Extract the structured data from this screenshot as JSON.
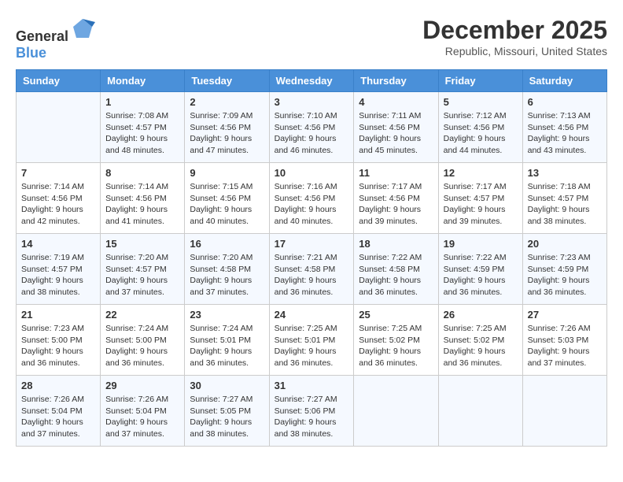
{
  "header": {
    "logo_general": "General",
    "logo_blue": "Blue",
    "title": "December 2025",
    "subtitle": "Republic, Missouri, United States"
  },
  "calendar": {
    "days_of_week": [
      "Sunday",
      "Monday",
      "Tuesday",
      "Wednesday",
      "Thursday",
      "Friday",
      "Saturday"
    ],
    "weeks": [
      [
        {
          "day": "",
          "info": ""
        },
        {
          "day": "1",
          "info": "Sunrise: 7:08 AM\nSunset: 4:57 PM\nDaylight: 9 hours\nand 48 minutes."
        },
        {
          "day": "2",
          "info": "Sunrise: 7:09 AM\nSunset: 4:56 PM\nDaylight: 9 hours\nand 47 minutes."
        },
        {
          "day": "3",
          "info": "Sunrise: 7:10 AM\nSunset: 4:56 PM\nDaylight: 9 hours\nand 46 minutes."
        },
        {
          "day": "4",
          "info": "Sunrise: 7:11 AM\nSunset: 4:56 PM\nDaylight: 9 hours\nand 45 minutes."
        },
        {
          "day": "5",
          "info": "Sunrise: 7:12 AM\nSunset: 4:56 PM\nDaylight: 9 hours\nand 44 minutes."
        },
        {
          "day": "6",
          "info": "Sunrise: 7:13 AM\nSunset: 4:56 PM\nDaylight: 9 hours\nand 43 minutes."
        }
      ],
      [
        {
          "day": "7",
          "info": "Sunrise: 7:14 AM\nSunset: 4:56 PM\nDaylight: 9 hours\nand 42 minutes."
        },
        {
          "day": "8",
          "info": "Sunrise: 7:14 AM\nSunset: 4:56 PM\nDaylight: 9 hours\nand 41 minutes."
        },
        {
          "day": "9",
          "info": "Sunrise: 7:15 AM\nSunset: 4:56 PM\nDaylight: 9 hours\nand 40 minutes."
        },
        {
          "day": "10",
          "info": "Sunrise: 7:16 AM\nSunset: 4:56 PM\nDaylight: 9 hours\nand 40 minutes."
        },
        {
          "day": "11",
          "info": "Sunrise: 7:17 AM\nSunset: 4:56 PM\nDaylight: 9 hours\nand 39 minutes."
        },
        {
          "day": "12",
          "info": "Sunrise: 7:17 AM\nSunset: 4:57 PM\nDaylight: 9 hours\nand 39 minutes."
        },
        {
          "day": "13",
          "info": "Sunrise: 7:18 AM\nSunset: 4:57 PM\nDaylight: 9 hours\nand 38 minutes."
        }
      ],
      [
        {
          "day": "14",
          "info": "Sunrise: 7:19 AM\nSunset: 4:57 PM\nDaylight: 9 hours\nand 38 minutes."
        },
        {
          "day": "15",
          "info": "Sunrise: 7:20 AM\nSunset: 4:57 PM\nDaylight: 9 hours\nand 37 minutes."
        },
        {
          "day": "16",
          "info": "Sunrise: 7:20 AM\nSunset: 4:58 PM\nDaylight: 9 hours\nand 37 minutes."
        },
        {
          "day": "17",
          "info": "Sunrise: 7:21 AM\nSunset: 4:58 PM\nDaylight: 9 hours\nand 36 minutes."
        },
        {
          "day": "18",
          "info": "Sunrise: 7:22 AM\nSunset: 4:58 PM\nDaylight: 9 hours\nand 36 minutes."
        },
        {
          "day": "19",
          "info": "Sunrise: 7:22 AM\nSunset: 4:59 PM\nDaylight: 9 hours\nand 36 minutes."
        },
        {
          "day": "20",
          "info": "Sunrise: 7:23 AM\nSunset: 4:59 PM\nDaylight: 9 hours\nand 36 minutes."
        }
      ],
      [
        {
          "day": "21",
          "info": "Sunrise: 7:23 AM\nSunset: 5:00 PM\nDaylight: 9 hours\nand 36 minutes."
        },
        {
          "day": "22",
          "info": "Sunrise: 7:24 AM\nSunset: 5:00 PM\nDaylight: 9 hours\nand 36 minutes."
        },
        {
          "day": "23",
          "info": "Sunrise: 7:24 AM\nSunset: 5:01 PM\nDaylight: 9 hours\nand 36 minutes."
        },
        {
          "day": "24",
          "info": "Sunrise: 7:25 AM\nSunset: 5:01 PM\nDaylight: 9 hours\nand 36 minutes."
        },
        {
          "day": "25",
          "info": "Sunrise: 7:25 AM\nSunset: 5:02 PM\nDaylight: 9 hours\nand 36 minutes."
        },
        {
          "day": "26",
          "info": "Sunrise: 7:25 AM\nSunset: 5:02 PM\nDaylight: 9 hours\nand 36 minutes."
        },
        {
          "day": "27",
          "info": "Sunrise: 7:26 AM\nSunset: 5:03 PM\nDaylight: 9 hours\nand 37 minutes."
        }
      ],
      [
        {
          "day": "28",
          "info": "Sunrise: 7:26 AM\nSunset: 5:04 PM\nDaylight: 9 hours\nand 37 minutes."
        },
        {
          "day": "29",
          "info": "Sunrise: 7:26 AM\nSunset: 5:04 PM\nDaylight: 9 hours\nand 37 minutes."
        },
        {
          "day": "30",
          "info": "Sunrise: 7:27 AM\nSunset: 5:05 PM\nDaylight: 9 hours\nand 38 minutes."
        },
        {
          "day": "31",
          "info": "Sunrise: 7:27 AM\nSunset: 5:06 PM\nDaylight: 9 hours\nand 38 minutes."
        },
        {
          "day": "",
          "info": ""
        },
        {
          "day": "",
          "info": ""
        },
        {
          "day": "",
          "info": ""
        }
      ]
    ]
  }
}
